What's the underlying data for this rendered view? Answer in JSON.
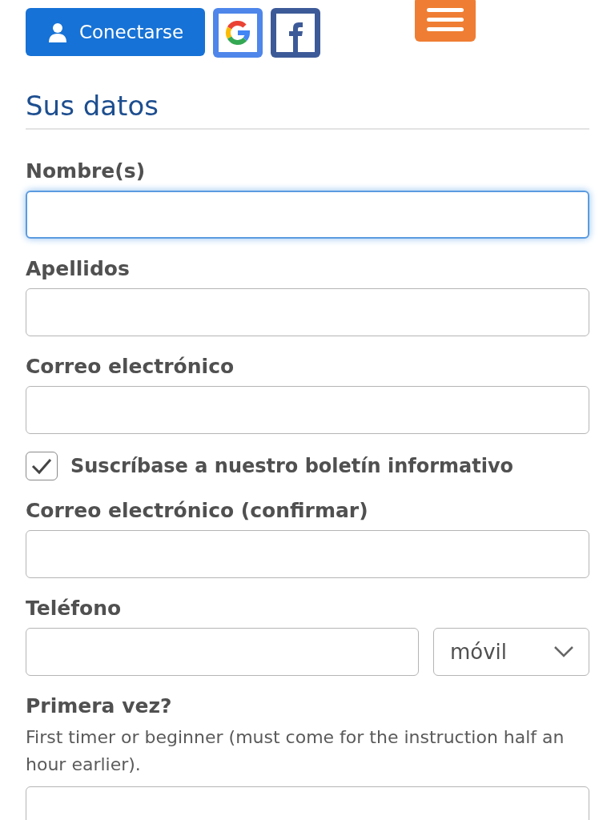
{
  "header": {
    "login_button": "Conectarse"
  },
  "section_title": "Sus datos",
  "fields": [
    {
      "kind": "text",
      "label": "Nombre(s)",
      "focused": true
    },
    {
      "kind": "text",
      "label": "Apellidos",
      "focused": false
    },
    {
      "kind": "text",
      "label": "Correo electrónico",
      "focused": false
    },
    {
      "kind": "checkbox",
      "label": "Suscríbase a nuestro boletín informativo",
      "checked": true
    },
    {
      "kind": "text",
      "label": "Correo electrónico (confirmar)",
      "focused": false
    },
    {
      "kind": "phone",
      "label": "Teléfono",
      "select_value": "móvil",
      "focused": false
    },
    {
      "kind": "text",
      "label": "Primera vez?",
      "description": "First timer or beginner (must come for the instruction half an hour earlier).",
      "focused": false
    }
  ]
}
